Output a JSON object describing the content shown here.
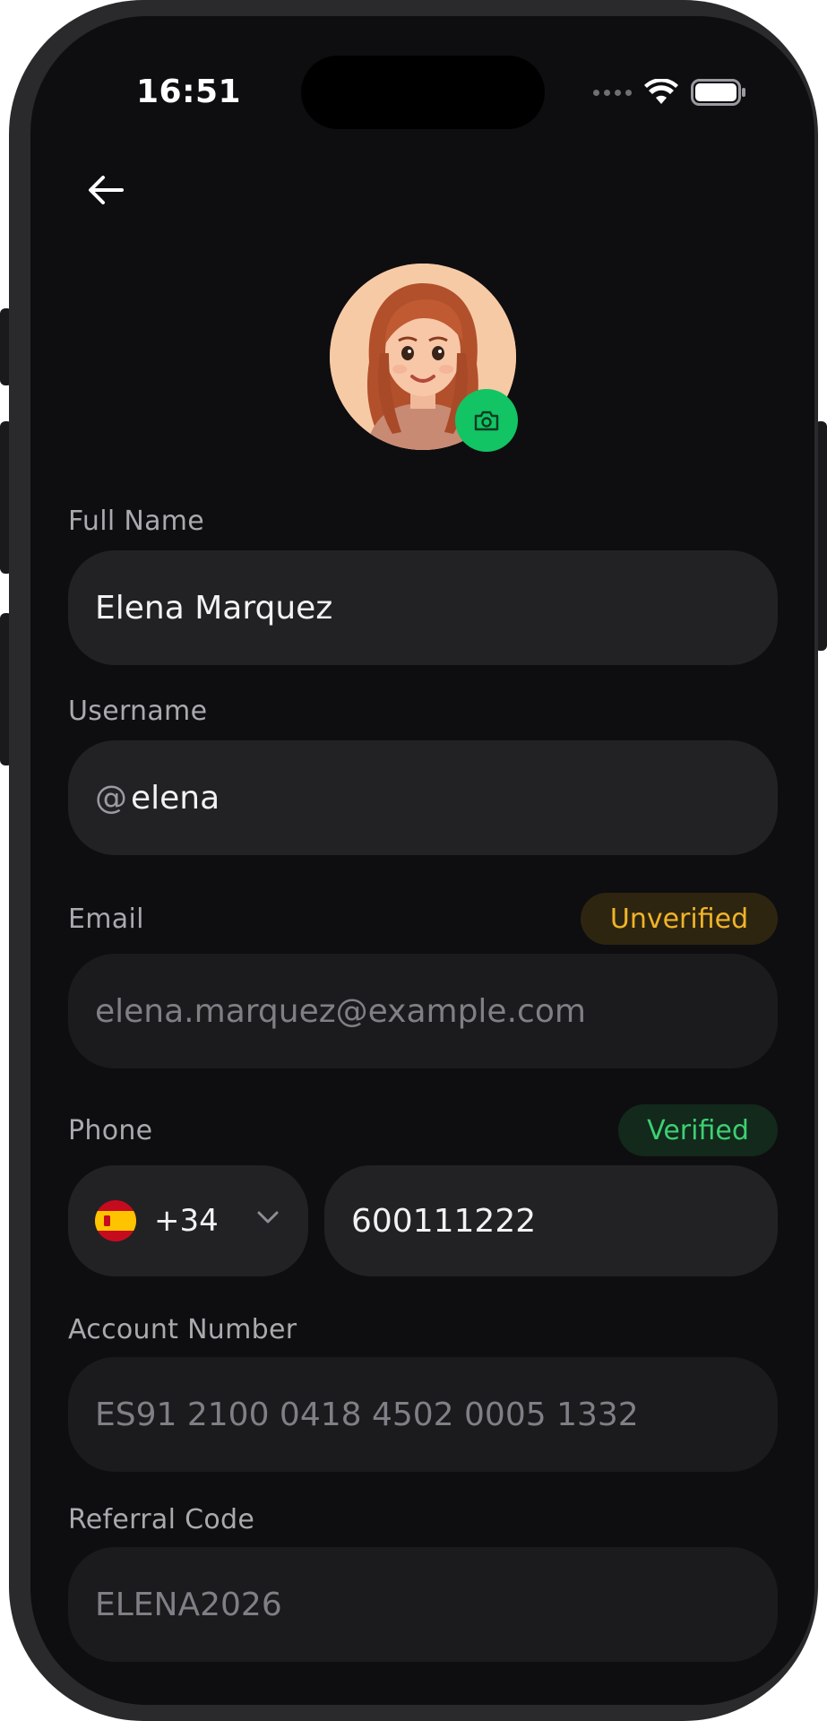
{
  "status_bar": {
    "time": "16:51"
  },
  "profile": {
    "full_name_label": "Full Name",
    "full_name_value": "Elena Marquez",
    "username_label": "Username",
    "username_prefix": "@",
    "username_value": "elena",
    "email_label": "Email",
    "email_badge": "Unverified",
    "email_value": "elena.marquez@example.com",
    "phone_label": "Phone",
    "phone_badge": "Verified",
    "country_code": "+34",
    "phone_value": "600111222",
    "account_label": "Account Number",
    "account_value": "ES91 2100 0418 4502 0005 1332",
    "referral_label": "Referral Code",
    "referral_value": "ELENA2026"
  },
  "colors": {
    "accent": "#12c464",
    "warning": "#f0b429",
    "success": "#3ecf72",
    "background": "#0e0e10",
    "field": "#222225"
  },
  "icons": {
    "back": "arrow-left-icon",
    "camera": "camera-icon",
    "flag": "spain-flag-icon",
    "dropdown": "chevron-down-icon"
  }
}
